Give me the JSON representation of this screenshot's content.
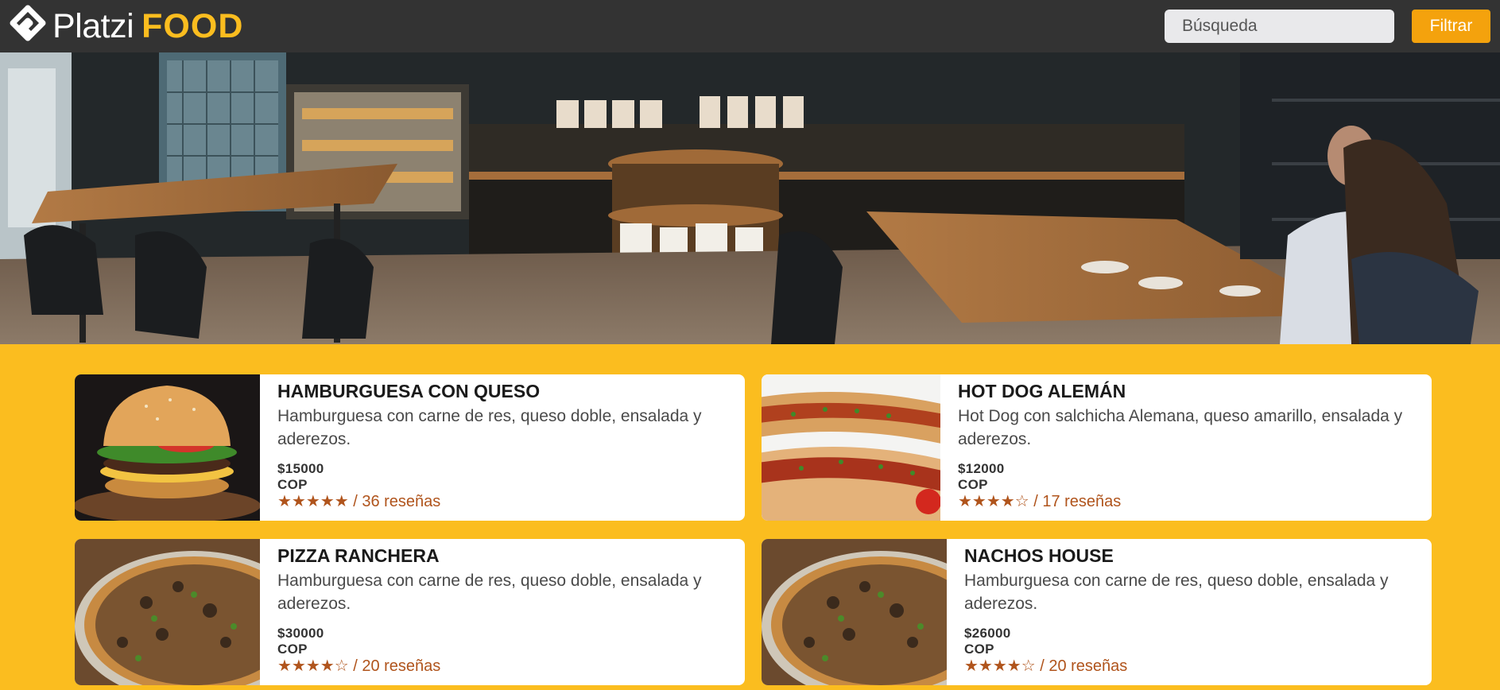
{
  "brand": {
    "name_part1": "Platzi",
    "name_part2": "FOOD",
    "icon": "platzi-logo-icon"
  },
  "search": {
    "placeholder": "Búsqueda"
  },
  "filter": {
    "label": "Filtrar"
  },
  "hero": {
    "image": "cafe-interior-photo"
  },
  "products": [
    {
      "title": "HAMBURGUESA CON QUESO",
      "description": "Hamburguesa con carne de res, queso doble, ensalada y aderezos.",
      "price": "$15000 COP",
      "stars": "★★★★★",
      "reviews": "/ 36 reseñas",
      "rating": 5,
      "image": "burger-photo"
    },
    {
      "title": "HOT DOG ALEMÁN",
      "description": "Hot Dog con salchicha Alemana, queso amarillo, ensalada y aderezos.",
      "price": "$12000 COP",
      "stars": "★★★★☆",
      "reviews": "/ 17 reseñas",
      "rating": 4,
      "image": "hotdog-photo"
    },
    {
      "title": "PIZZA RANCHERA",
      "description": "Hamburguesa con carne de res, queso doble, ensalada y aderezos.",
      "price": "$30000 COP",
      "stars": "★★★★☆",
      "reviews": "/ 20 reseñas",
      "rating": 4,
      "image": "pizza-photo"
    },
    {
      "title": "NACHOS HOUSE",
      "description": "Hamburguesa con carne de res, queso doble, ensalada y aderezos.",
      "price": "$26000 COP",
      "stars": "★★★★☆",
      "reviews": "/ 20 reseñas",
      "rating": 4,
      "image": "pizza-photo"
    }
  ],
  "colors": {
    "navbar": "#333333",
    "accent": "#fbbd1f",
    "button": "#f4a20d",
    "rating": "#b0541c"
  }
}
